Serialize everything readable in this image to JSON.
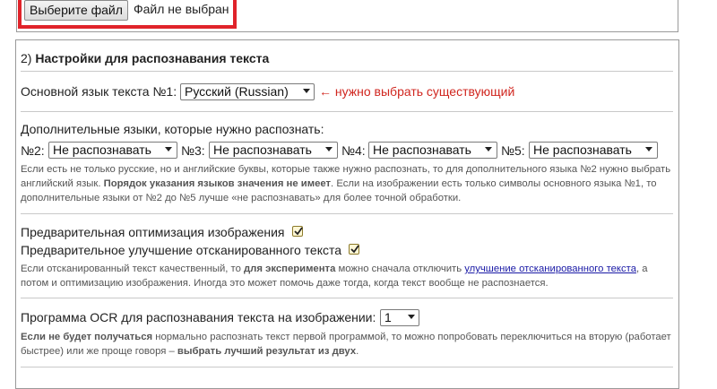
{
  "file_upload": {
    "button_label": "Выберите файл",
    "status": "Файл не выбран"
  },
  "settings": {
    "header_number": "2)",
    "header_title": "Настройки для распознавания текста",
    "main_language": {
      "label": "Основной язык текста №1:",
      "selected": "Русский (Russian)",
      "hint": "← нужно выбрать существующий"
    },
    "additional_languages": {
      "label": "Дополнительные языки, которые нужно распознать:",
      "slots": [
        {
          "label": "№2:",
          "selected": "Не распознавать"
        },
        {
          "label": "№3:",
          "selected": "Не распознавать"
        },
        {
          "label": "№4:",
          "selected": "Не распознавать"
        },
        {
          "label": "№5:",
          "selected": "Не распознавать"
        }
      ],
      "note_part1": "Если есть не только русские, но и английские буквы, которые также нужно распознать, то для дополнительного языка №2 нужно выбрать английский язык. ",
      "note_bold": "Порядок указания языков значения не имеет",
      "note_part2": ". Если на изображении есть только символы основного языка №1, то дополнительные языки от №2 до №5 лучше «не распознавать» для более точной обработки."
    },
    "optimization": {
      "label": "Предварительная оптимизация изображения",
      "checked": true
    },
    "enhancement": {
      "label": "Предварительное улучшение отсканированного текста",
      "checked": true
    },
    "enhance_note": {
      "part1": "Если отсканированный текст качественный, то ",
      "bold": "для эксперимента",
      "part2": " можно сначала отключить ",
      "link": "улучшение отсканированного текста",
      "part3": ", а потом и оптимизацию изображения. Иногда это может помочь даже тогда, когда текст вообще не распознается."
    },
    "ocr_program": {
      "label": "Программа OCR для распознавания текста на изображении:",
      "selected": "1"
    },
    "ocr_note": {
      "bold1": "Если не будет получаться",
      "part1": " нормально распознать текст первой программой, то можно попробовать переключиться на вторую (работает быстрее) или же проще говоря – ",
      "bold2": "выбрать лучший результат из двух",
      "part2": "."
    }
  },
  "colors": {
    "highlight_border": "#e0232a",
    "hint_text": "#d0261f",
    "link": "#1a1aa6",
    "checkbox_fill": "#fff7d6"
  }
}
